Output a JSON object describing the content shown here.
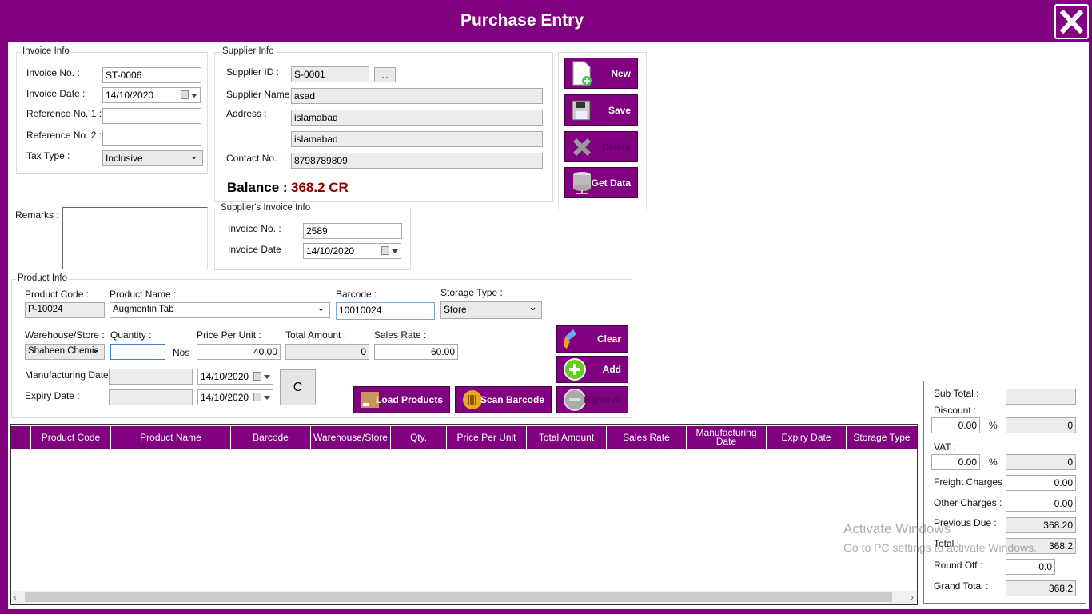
{
  "window": {
    "title": "Purchase Entry"
  },
  "invoice_info": {
    "legend": "Invoice Info",
    "invoice_no_label": "Invoice No. :",
    "invoice_no": "ST-0006",
    "invoice_date_label": "Invoice Date :",
    "invoice_date": "14/10/2020",
    "ref1_label": "Reference No. 1 :",
    "ref1": "",
    "ref2_label": "Reference No. 2 :",
    "ref2": "",
    "tax_type_label": "Tax Type :",
    "tax_type": "Inclusive"
  },
  "supplier_info": {
    "legend": "Supplier Info",
    "supplier_id_label": "Supplier ID :",
    "supplier_id": "S-0001",
    "browse_label": "...",
    "name_label": "Supplier Name :",
    "name": "asad",
    "address_label": "Address :",
    "address1": "islamabad",
    "address2": "islamabad",
    "contact_label": "Contact No. :",
    "contact": "8798789809",
    "balance_label": "Balance :",
    "balance": "368.2 CR"
  },
  "actions": {
    "new": "New",
    "save": "Save",
    "delete": "Delete",
    "get_data": "Get Data"
  },
  "remarks": {
    "label": "Remarks :",
    "value": ""
  },
  "supplier_invoice": {
    "legend": "Supplier's Invoice Info",
    "invoice_no_label": "Invoice No. :",
    "invoice_no": "2589",
    "invoice_date_label": "Invoice Date :",
    "invoice_date": "14/10/2020"
  },
  "product_info": {
    "legend": "Product Info",
    "product_code_label": "Product Code :",
    "product_code": "P-10024",
    "product_name_label": "Product Name :",
    "product_name": "Augmentin Tab",
    "barcode_label": "Barcode :",
    "barcode": "10010024",
    "storage_type_label": "Storage Type :",
    "storage_type": "Store",
    "warehouse_label": "Warehouse/Store :",
    "warehouse": "Shaheen Chemis",
    "quantity_label": "Quantity :",
    "quantity": "",
    "unit": "Nos",
    "price_label": "Price Per Unit :",
    "price": "40.00",
    "total_label": "Total Amount :",
    "total": "0",
    "sales_rate_label": "Sales Rate :",
    "sales_rate": "60.00",
    "mfg_label": "Manufacturing Date :",
    "mfg_date": "14/10/2020",
    "expiry_label": "Expiry Date :",
    "expiry_date": "14/10/2020",
    "c_label": "C",
    "clear": "Clear",
    "add": "Add",
    "remove": "Remove",
    "load_products": "Load Products",
    "scan_barcode": "Scan Barcode"
  },
  "grid": {
    "columns": [
      "Product Code",
      "Product Name",
      "Barcode",
      "Warehouse/Store",
      "Qty.",
      "Price Per Unit",
      "Total Amount",
      "Sales Rate",
      "Manufacturing Date",
      "Expiry Date",
      "Storage Type"
    ],
    "rows": []
  },
  "summary": {
    "sub_total_label": "Sub Total :",
    "sub_total": "",
    "discount_label": "Discount :",
    "discount_pct": "0.00",
    "discount_amt": "0",
    "vat_label": "VAT :",
    "vat_pct": "0.00",
    "vat_amt": "0",
    "pct": "%",
    "freight_label": "Freight Charges :",
    "freight": "0.00",
    "other_label": "Other Charges :",
    "other": "0.00",
    "prev_due_label": "Previous Due :",
    "prev_due": "368.20",
    "total_label": "Total :",
    "total": "368.2",
    "round_off_label": "Round Off :",
    "round_off": "0.0",
    "grand_total_label": "Grand Total :",
    "grand_total": "368.2"
  },
  "watermark": {
    "line1": "Activate Windows",
    "line2": "Go to PC settings to activate Windows."
  },
  "colors": {
    "brand": "#800080",
    "balance": "#8b0000"
  }
}
